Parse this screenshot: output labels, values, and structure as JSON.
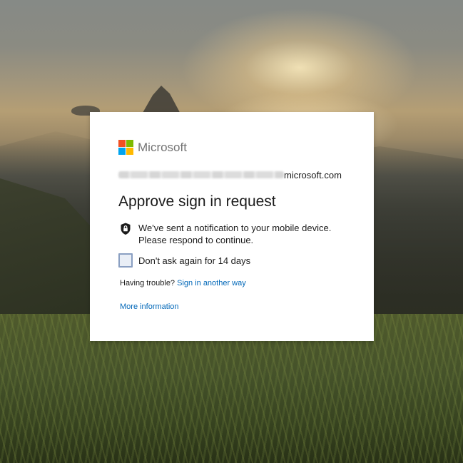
{
  "brand": {
    "name": "Microsoft",
    "logo_colors": [
      "#f25022",
      "#7fba00",
      "#00a4ef",
      "#ffb900"
    ]
  },
  "identity": {
    "visible_suffix": "microsoft.com"
  },
  "title": "Approve sign in request",
  "notice": {
    "icon": "lock-shield-icon",
    "line1": "We've sent a notification to your mobile device.",
    "line2": "Please respond to continue."
  },
  "remember": {
    "label": "Don't ask again for 14 days",
    "checked": false
  },
  "trouble": {
    "prefix": "Having trouble?",
    "link": "Sign in another way"
  },
  "more_info": "More information",
  "colors": {
    "link": "#0067b8",
    "text": "#1b1b1b",
    "brand_text": "#737373"
  }
}
